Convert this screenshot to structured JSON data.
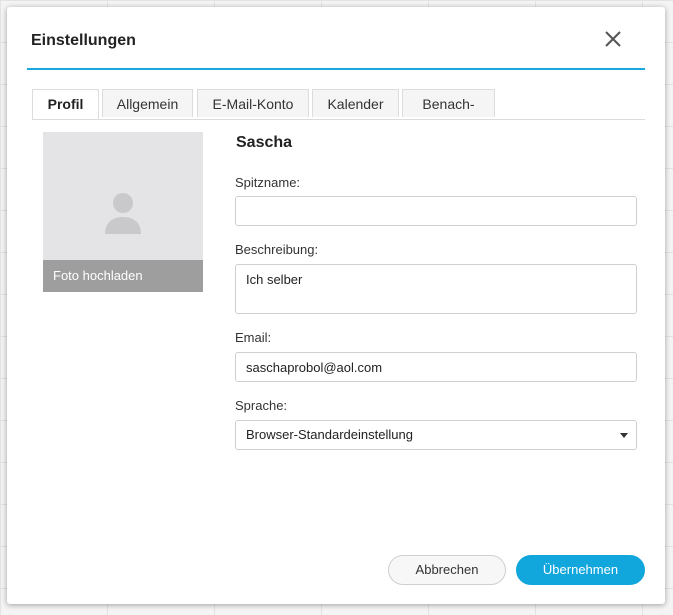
{
  "dialog": {
    "title": "Einstellungen"
  },
  "tabs": [
    {
      "label": "Profil",
      "active": true
    },
    {
      "label": "Allgemein",
      "active": false
    },
    {
      "label": "E-Mail-Konto",
      "active": false
    },
    {
      "label": "Kalender",
      "active": false
    },
    {
      "label": "Benach-",
      "active": false
    }
  ],
  "profile": {
    "upload_label": "Foto hochladen",
    "name": "Sascha",
    "nickname": {
      "label": "Spitzname:",
      "value": ""
    },
    "description": {
      "label": "Beschreibung:",
      "value": "Ich selber"
    },
    "email": {
      "label": "Email:",
      "value": "saschaprobol@aol.com"
    },
    "language": {
      "label": "Sprache:",
      "selected": "Browser-Standardeinstellung"
    }
  },
  "actions": {
    "cancel_label": "Abbrechen",
    "apply_label": "Übernehmen"
  },
  "colors": {
    "accent": "#11a6dc",
    "title_rule": "#1aa7dc"
  },
  "icons": {
    "close": "close-icon",
    "avatar": "person-icon",
    "dropdown": "chevron-down-icon"
  }
}
